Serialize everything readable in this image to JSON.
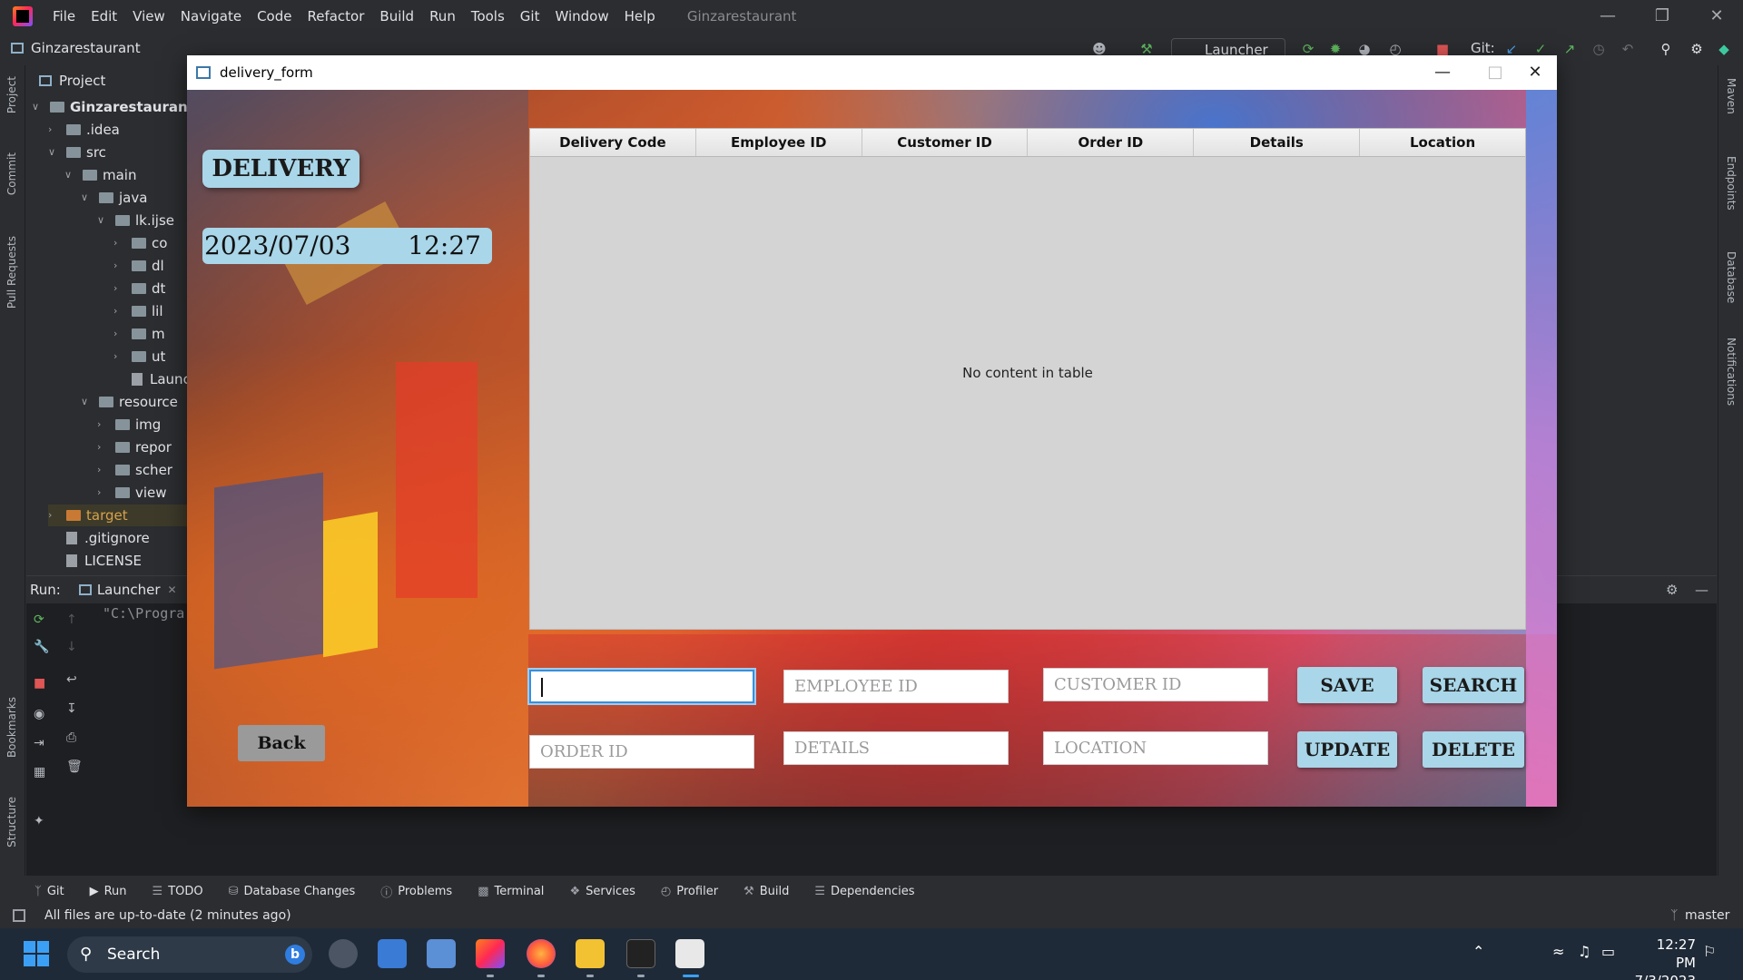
{
  "ide": {
    "menu": [
      "File",
      "Edit",
      "View",
      "Navigate",
      "Code",
      "Refactor",
      "Build",
      "Run",
      "Tools",
      "Git",
      "Window",
      "Help"
    ],
    "project_name": "Ginzarestaurant",
    "run_config": "Launcher",
    "git_label": "Git:",
    "left_stripe": [
      "Project",
      "Commit",
      "Pull Requests",
      "Bookmarks",
      "Structure"
    ],
    "right_stripe": [
      "Maven",
      "Endpoints",
      "Database",
      "Notifications"
    ],
    "project_panel_title": "Project",
    "tree": [
      {
        "label": "Ginzarestaurant",
        "level": 0,
        "kind": "folder",
        "expanded": true
      },
      {
        "label": ".idea",
        "level": 1,
        "kind": "folder",
        "expanded": false
      },
      {
        "label": "src",
        "level": 1,
        "kind": "folder",
        "expanded": true
      },
      {
        "label": "main",
        "level": 2,
        "kind": "folder",
        "expanded": true
      },
      {
        "label": "java",
        "level": 3,
        "kind": "folder",
        "expanded": true
      },
      {
        "label": "lk.ijse",
        "level": 4,
        "kind": "folder",
        "expanded": true
      },
      {
        "label": "co",
        "level": 5,
        "kind": "folder",
        "expanded": false
      },
      {
        "label": "dl",
        "level": 5,
        "kind": "folder",
        "expanded": false
      },
      {
        "label": "dt",
        "level": 5,
        "kind": "folder",
        "expanded": false
      },
      {
        "label": "lil",
        "level": 5,
        "kind": "folder",
        "expanded": false
      },
      {
        "label": "m",
        "level": 5,
        "kind": "folder",
        "expanded": false
      },
      {
        "label": "ut",
        "level": 5,
        "kind": "folder",
        "expanded": false
      },
      {
        "label": "Launc",
        "level": 5,
        "kind": "file",
        "expanded": null
      },
      {
        "label": "resource",
        "level": 3,
        "kind": "folder",
        "expanded": true
      },
      {
        "label": "img",
        "level": 4,
        "kind": "folder",
        "expanded": false
      },
      {
        "label": "repor",
        "level": 4,
        "kind": "folder",
        "expanded": false
      },
      {
        "label": "scher",
        "level": 4,
        "kind": "folder",
        "expanded": false
      },
      {
        "label": "view",
        "level": 4,
        "kind": "folder",
        "expanded": false
      },
      {
        "label": "target",
        "level": 1,
        "kind": "folder",
        "expanded": false
      },
      {
        "label": ".gitignore",
        "level": 1,
        "kind": "file",
        "expanded": null
      },
      {
        "label": "LICENSE",
        "level": 1,
        "kind": "file",
        "expanded": null
      }
    ],
    "run_label": "Run:",
    "run_tab": "Launcher",
    "console_text": "\"C:\\Progra",
    "bottom_tools": [
      "Git",
      "Run",
      "TODO",
      "Database Changes",
      "Problems",
      "Terminal",
      "Services",
      "Profiler",
      "Build",
      "Dependencies"
    ],
    "status_text": "All files are up-to-date (2 minutes ago)",
    "branch": "master"
  },
  "taskbar": {
    "search_placeholder": "Search",
    "time": "12:27 PM",
    "date": "7/3/2023"
  },
  "app": {
    "window_title": "delivery_form",
    "heading": "DELIVERY",
    "date": "2023/07/03",
    "time": "12:27",
    "table": {
      "columns": [
        "Delivery Code",
        "Employee ID",
        "Customer ID",
        "Order ID",
        "Details",
        "Location"
      ],
      "rows": [],
      "empty_message": "No content in table"
    },
    "fields": {
      "delivery_code": {
        "value": "",
        "placeholder": ""
      },
      "employee_id": {
        "value": "",
        "placeholder": "EMPLOYEE ID"
      },
      "customer_id": {
        "value": "",
        "placeholder": "CUSTOMER ID"
      },
      "order_id": {
        "value": "",
        "placeholder": "ORDER ID"
      },
      "details": {
        "value": "",
        "placeholder": "DETAILS"
      },
      "location": {
        "value": "",
        "placeholder": "LOCATION"
      }
    },
    "buttons": {
      "save": "SAVE",
      "search": "SEARCH",
      "update": "UPDATE",
      "delete": "DELETE",
      "back": "Back"
    },
    "colors": {
      "accent": "#a9d6e8",
      "back_button": "#9a9a9a",
      "table_bg": "#d4d4d4"
    }
  }
}
